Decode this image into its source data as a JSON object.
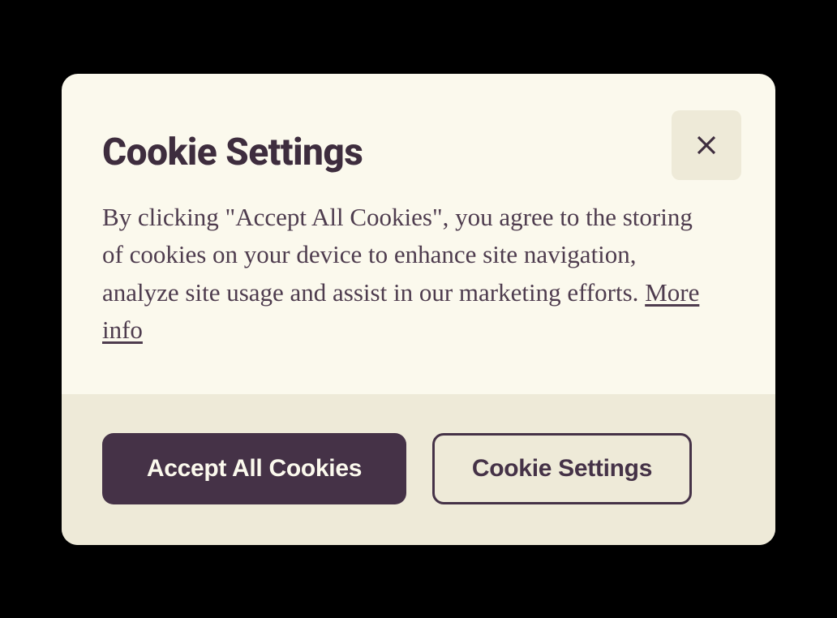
{
  "dialog": {
    "title": "Cookie Settings",
    "body_text": "By clicking \"Accept All Cookies\", you agree to the storing of cookies on your device to enhance site navigation, analyze site usage and assist in our marketing efforts. ",
    "more_info_label": "More info"
  },
  "footer": {
    "accept_label": "Accept All Cookies",
    "settings_label": "Cookie Settings"
  },
  "icons": {
    "close": "close-icon"
  },
  "colors": {
    "dialog_bg": "#FBF9ED",
    "footer_bg": "#EEEAD8",
    "accent_dark": "#453247",
    "text_dark": "#3E2D3E"
  }
}
